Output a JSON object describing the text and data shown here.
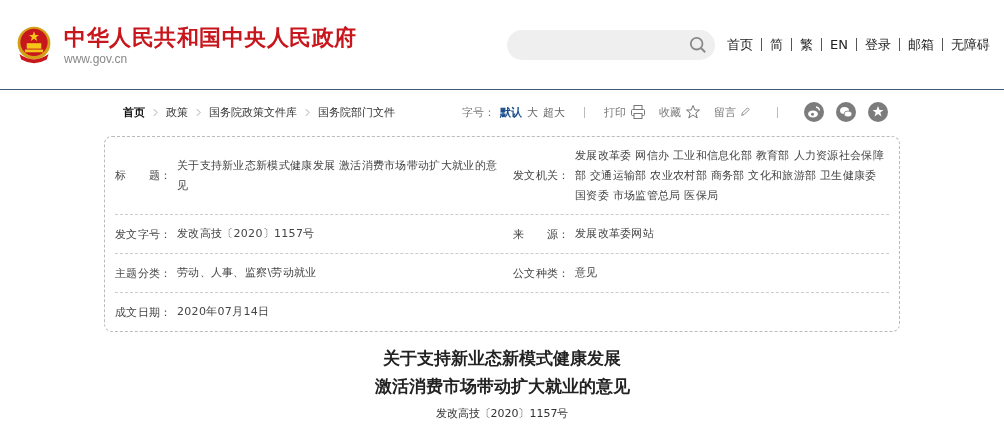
{
  "header": {
    "site_name": "中华人民共和国中央人民政府",
    "site_url": "www.gov.cn",
    "nav": [
      "首页",
      "简",
      "繁",
      "EN",
      "登录",
      "邮箱",
      "无障碍"
    ]
  },
  "breadcrumb": [
    "首页",
    "政策",
    "国务院政策文件库",
    "国务院部门文件"
  ],
  "tools": {
    "size_label": "字号：",
    "sizes": [
      {
        "label": "默认",
        "selected": true
      },
      {
        "label": "大",
        "selected": false
      },
      {
        "label": "超大",
        "selected": false
      }
    ],
    "actions": [
      {
        "label": "打印",
        "kind": "print"
      },
      {
        "label": "收藏",
        "kind": "star"
      },
      {
        "label": "留言",
        "kind": "pen"
      }
    ],
    "share": [
      {
        "kind": "weibo"
      },
      {
        "kind": "wechat"
      },
      {
        "kind": "favorite"
      }
    ]
  },
  "info": [
    {
      "label": "标　　题：",
      "value": "关于支持新业态新模式健康发展 激活消费市场带动扩大就业的意见",
      "label2": "发文机关：",
      "value2": "发展改革委 网信办 工业和信息化部 教育部 人力资源社会保障部 交通运输部 农业农村部 商务部 文化和旅游部 卫生健康委国资委 市场监管总局 医保局"
    },
    {
      "label": "发文字号：",
      "value": "发改高技〔2020〕1157号",
      "label2": "来　　源：",
      "value2": "发展改革委网站"
    },
    {
      "label": "主题分类：",
      "value": "劳动、人事、监察\\劳动就业",
      "label2": "公文种类：",
      "value2": "意见"
    },
    {
      "label": "成文日期：",
      "value": "2020年07月14日"
    }
  ],
  "article": {
    "title_lines": [
      "关于支持新业态新模式健康发展",
      "激活消费市场带动扩大就业的意见"
    ],
    "doc_number": "发改高技〔2020〕1157号"
  }
}
